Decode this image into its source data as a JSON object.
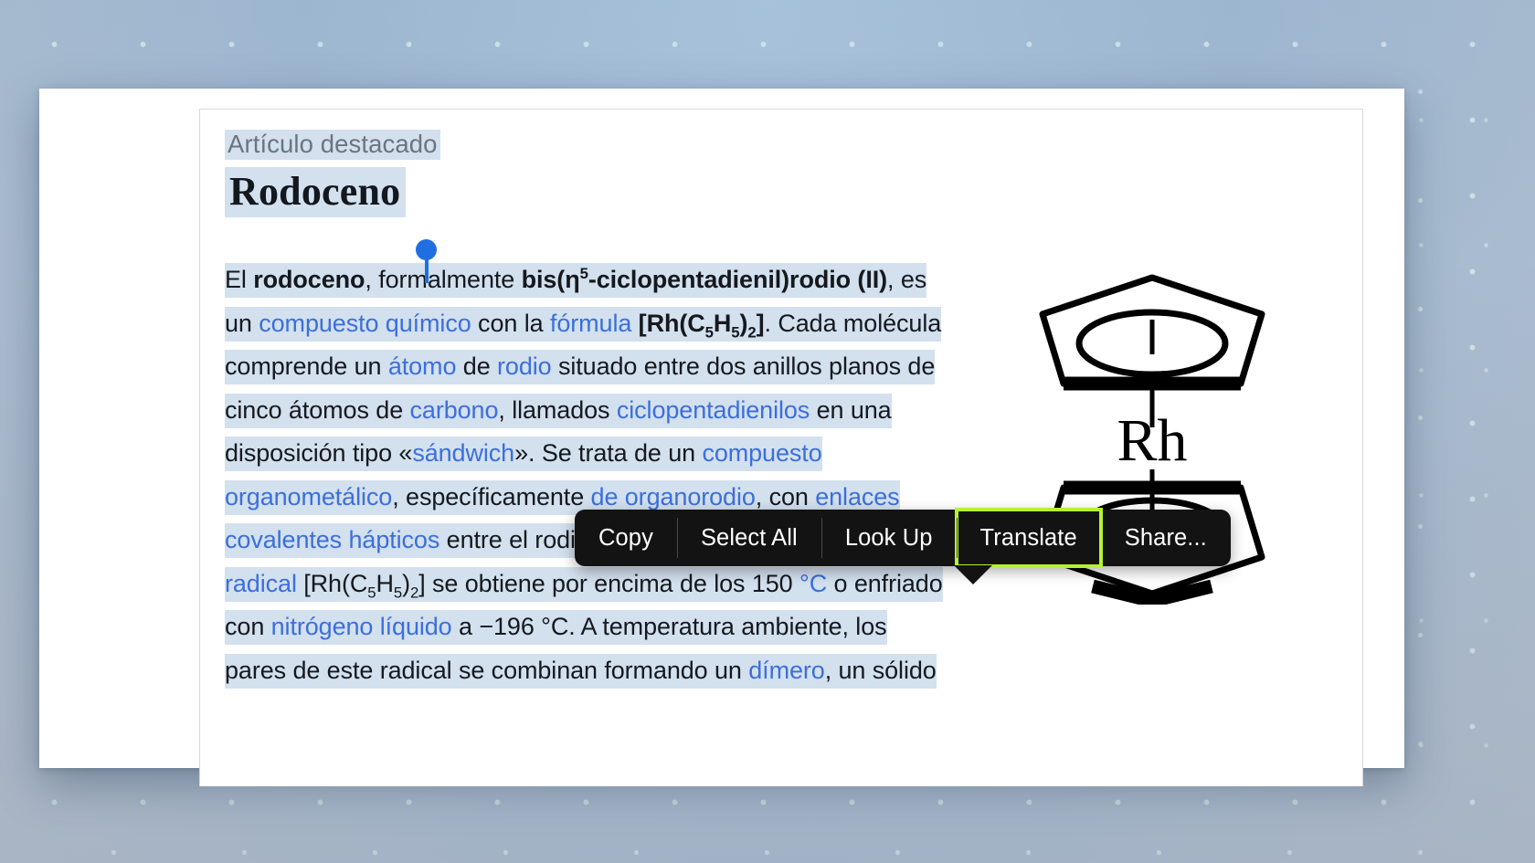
{
  "article": {
    "tagline": "Artículo destacado",
    "title": "Rodoceno",
    "paragraph_plain": "El rodoceno, formalmente bis(η5-ciclopentadienil)rodio (II), es un compuesto químico con la fórmula [Rh(C5H5)2]. Cada molécula comprende un átomo de rodio situado entre dos anillos planos de cinco átomos de carbono, llamados ciclopentadienilos en una disposición tipo «sándwich». Se trata de un compuesto organometálico, específicamente de organorodio, con enlaces covalentes hápticos entre el rodio y los átomos de carbono. El radical [Rh(C5H5)2] se obtiene por encima de los 150 °C o enfriado con nitrógeno líquido a –196 °C. A temperatura ambiente, los pares de este radical se combinan formando un dímero, un sólido",
    "links": [
      "compuesto químico",
      "fórmula",
      "átomo",
      "rodio",
      "carbono",
      "ciclopentadienilos",
      "sándwich",
      "compuesto organometálico",
      "de organorodio",
      "enlaces covalentes hápticos",
      "radical",
      "°C",
      "nitrógeno líquido",
      "dímero"
    ],
    "figure_label": "Rh",
    "figure_alt": "rhodocene-sandwich-structure"
  },
  "context_menu": {
    "items": [
      {
        "label": "Copy",
        "focused": false
      },
      {
        "label": "Select All",
        "focused": false
      },
      {
        "label": "Look Up",
        "focused": false
      },
      {
        "label": "Translate",
        "focused": true
      },
      {
        "label": "Share...",
        "focused": false
      }
    ]
  },
  "selection": {
    "start_handle": "selection-start-handle",
    "end_handle": "selection-end-handle",
    "highlight_color": "#d3e0ee"
  },
  "colors": {
    "link": "#3b6fdc",
    "menu_background": "#131313",
    "focus_ring": "#b4f233",
    "handle": "#1f6fe0",
    "desktop": "#a4bdd4"
  }
}
